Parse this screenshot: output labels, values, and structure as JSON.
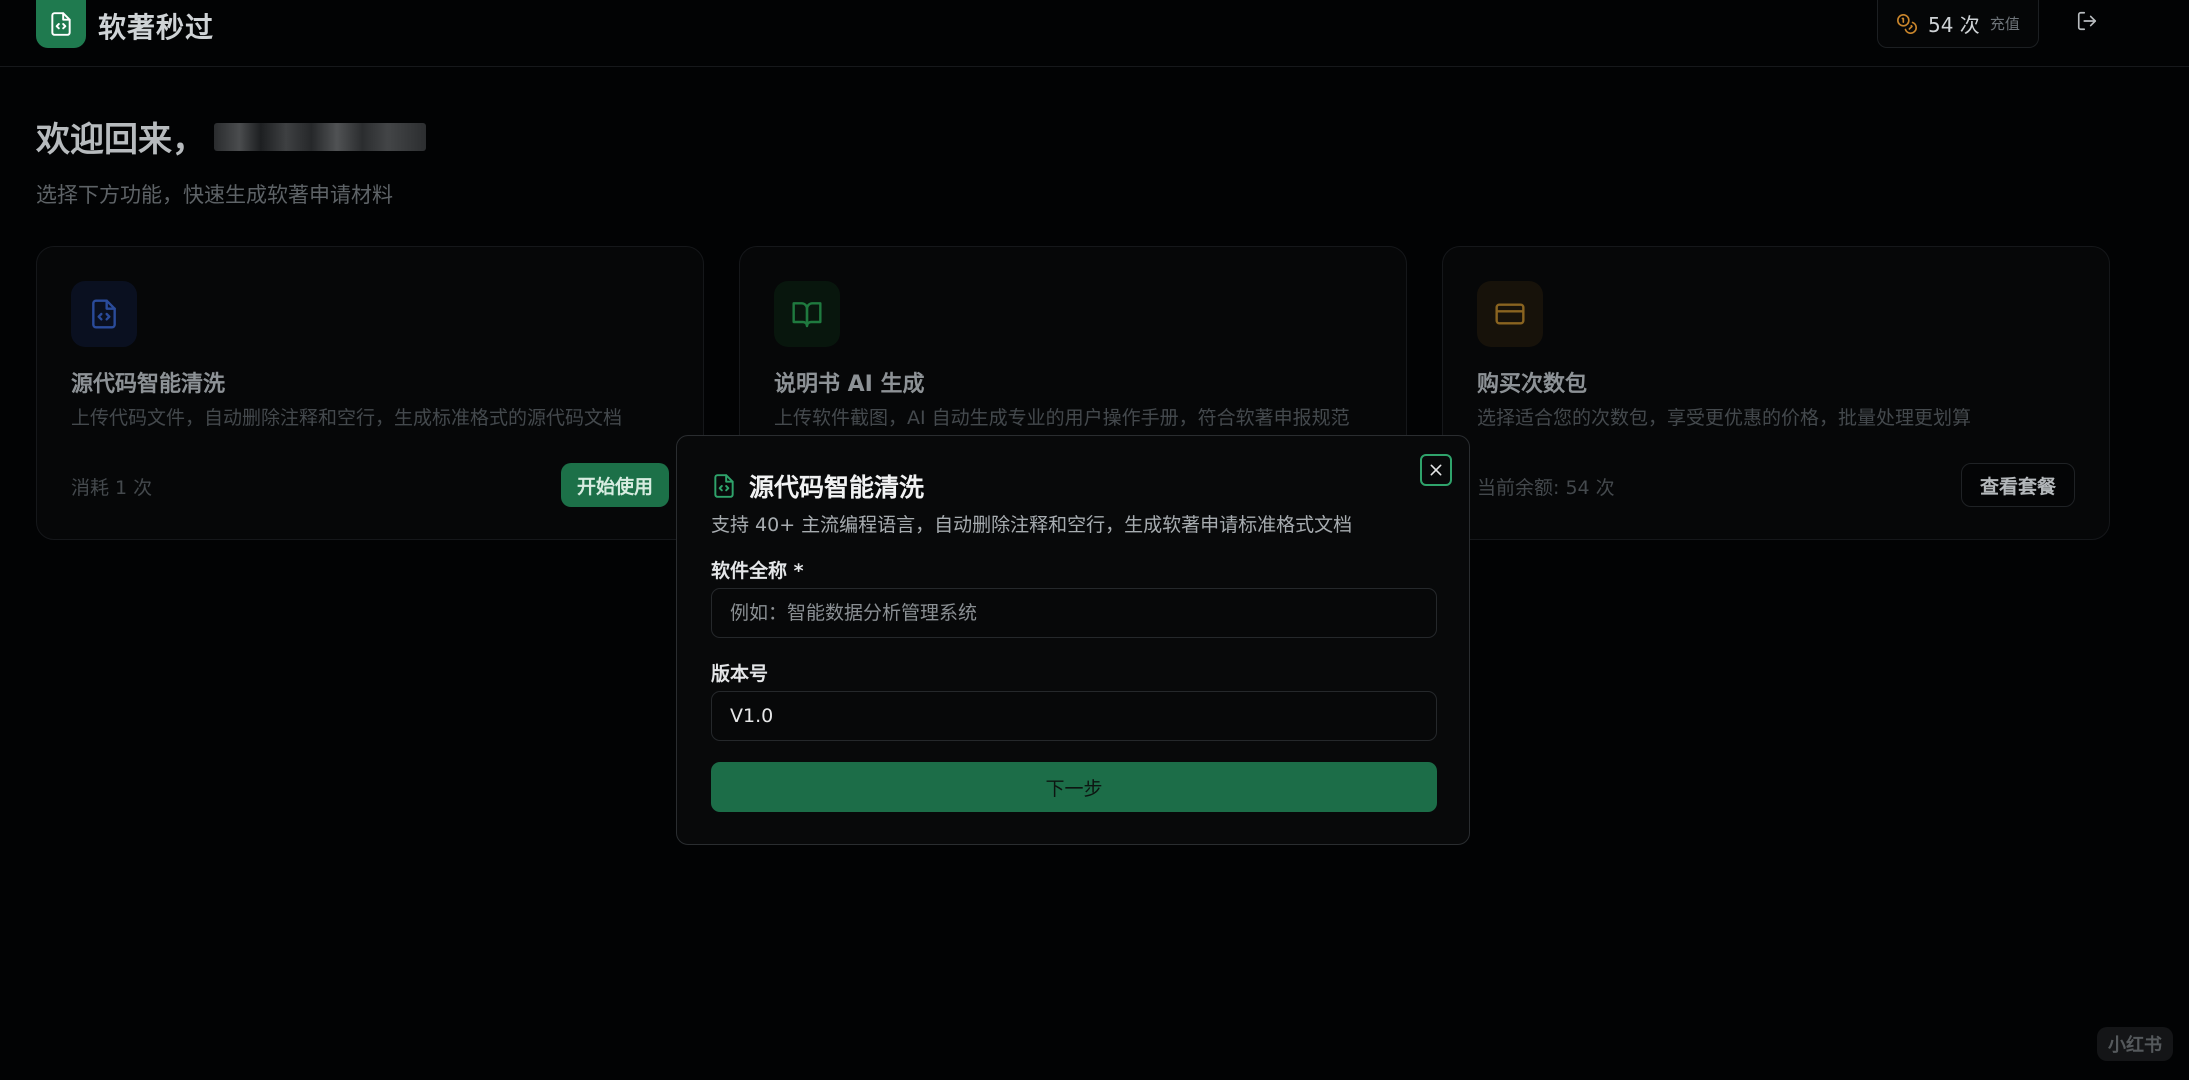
{
  "header": {
    "app_title": "软著秒过",
    "credits_count": "54 次",
    "recharge_label": "充值"
  },
  "welcome": {
    "title": "欢迎回来，",
    "subtitle": "选择下方功能，快速生成软著申请材料"
  },
  "cards": [
    {
      "title": "源代码智能清洗",
      "description": "上传代码文件，自动删除注释和空行，生成标准格式的源代码文档",
      "meta": "消耗 1 次",
      "button": "开始使用",
      "icon": "file-code-icon",
      "accent": "#1e3a8a"
    },
    {
      "title": "说明书 AI 生成",
      "description": "上传软件截图，AI 自动生成专业的用户操作手册，符合软著申报规范",
      "icon": "book-open-icon",
      "accent": "#14532d"
    },
    {
      "title": "购买次数包",
      "description": "选择适合您的次数包，享受更优惠的价格，批量处理更划算",
      "meta": "当前余额: 54 次",
      "button": "查看套餐",
      "icon": "credit-card-icon",
      "accent": "#a16207"
    }
  ],
  "modal": {
    "title": "源代码智能清洗",
    "description": "支持 40+ 主流编程语言，自动删除注释和空行，生成软著申请标准格式文档",
    "name_label": "软件全称 *",
    "name_placeholder": "例如：智能数据分析管理系统",
    "version_label": "版本号",
    "version_value": "V1.0",
    "submit_label": "下一步"
  },
  "watermark": "小红书",
  "colors": {
    "brand_green": "#1f7a4f",
    "background": "#020304"
  }
}
